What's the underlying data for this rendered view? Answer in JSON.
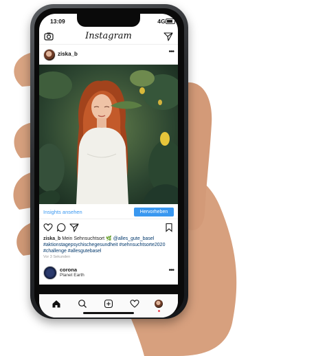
{
  "status_bar": {
    "time": "13:09",
    "network": "4G"
  },
  "app": {
    "title": "Instagram"
  },
  "post": {
    "username": "ziska_b",
    "insights_link": "Insights ansehen",
    "promote_button": "Hervorheben",
    "caption_user": "ziska_b",
    "caption_text": " Mein Sehnsuchtsort 🌿 ",
    "caption_mention": "@alles_gute_basel",
    "caption_tags_1": "#aktionstagepsychischegesundheit #sehnsuchtsorte2020",
    "caption_tags_2": "#challenge #allesgutebasel",
    "time_ago": "Vor 3 Sekunden"
  },
  "story": {
    "name": "corona",
    "subtitle": "Planet Earth"
  },
  "icons": [
    "camera-icon",
    "send-icon",
    "more-icon",
    "heart-icon",
    "comment-icon",
    "share-icon",
    "bookmark-icon",
    "home-icon",
    "search-icon",
    "add-icon",
    "activity-icon",
    "profile-icon"
  ]
}
